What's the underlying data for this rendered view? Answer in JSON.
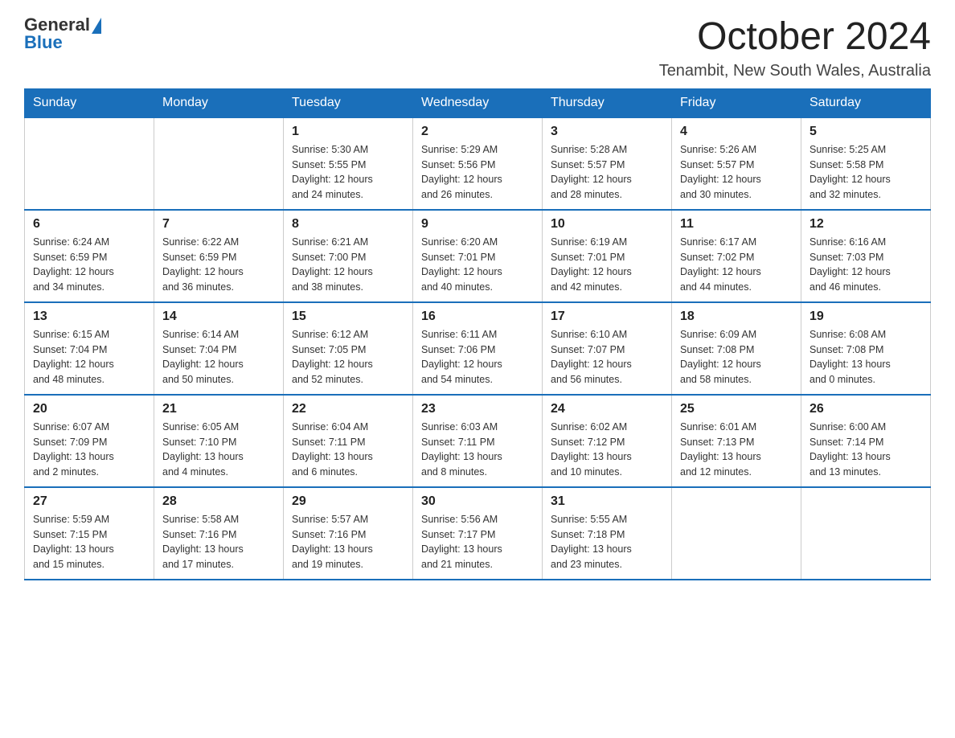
{
  "header": {
    "logo_general": "General",
    "logo_blue": "Blue",
    "month_year": "October 2024",
    "location": "Tenambit, New South Wales, Australia"
  },
  "weekdays": [
    "Sunday",
    "Monday",
    "Tuesday",
    "Wednesday",
    "Thursday",
    "Friday",
    "Saturday"
  ],
  "weeks": [
    [
      {
        "day": "",
        "info": ""
      },
      {
        "day": "",
        "info": ""
      },
      {
        "day": "1",
        "info": "Sunrise: 5:30 AM\nSunset: 5:55 PM\nDaylight: 12 hours\nand 24 minutes."
      },
      {
        "day": "2",
        "info": "Sunrise: 5:29 AM\nSunset: 5:56 PM\nDaylight: 12 hours\nand 26 minutes."
      },
      {
        "day": "3",
        "info": "Sunrise: 5:28 AM\nSunset: 5:57 PM\nDaylight: 12 hours\nand 28 minutes."
      },
      {
        "day": "4",
        "info": "Sunrise: 5:26 AM\nSunset: 5:57 PM\nDaylight: 12 hours\nand 30 minutes."
      },
      {
        "day": "5",
        "info": "Sunrise: 5:25 AM\nSunset: 5:58 PM\nDaylight: 12 hours\nand 32 minutes."
      }
    ],
    [
      {
        "day": "6",
        "info": "Sunrise: 6:24 AM\nSunset: 6:59 PM\nDaylight: 12 hours\nand 34 minutes."
      },
      {
        "day": "7",
        "info": "Sunrise: 6:22 AM\nSunset: 6:59 PM\nDaylight: 12 hours\nand 36 minutes."
      },
      {
        "day": "8",
        "info": "Sunrise: 6:21 AM\nSunset: 7:00 PM\nDaylight: 12 hours\nand 38 minutes."
      },
      {
        "day": "9",
        "info": "Sunrise: 6:20 AM\nSunset: 7:01 PM\nDaylight: 12 hours\nand 40 minutes."
      },
      {
        "day": "10",
        "info": "Sunrise: 6:19 AM\nSunset: 7:01 PM\nDaylight: 12 hours\nand 42 minutes."
      },
      {
        "day": "11",
        "info": "Sunrise: 6:17 AM\nSunset: 7:02 PM\nDaylight: 12 hours\nand 44 minutes."
      },
      {
        "day": "12",
        "info": "Sunrise: 6:16 AM\nSunset: 7:03 PM\nDaylight: 12 hours\nand 46 minutes."
      }
    ],
    [
      {
        "day": "13",
        "info": "Sunrise: 6:15 AM\nSunset: 7:04 PM\nDaylight: 12 hours\nand 48 minutes."
      },
      {
        "day": "14",
        "info": "Sunrise: 6:14 AM\nSunset: 7:04 PM\nDaylight: 12 hours\nand 50 minutes."
      },
      {
        "day": "15",
        "info": "Sunrise: 6:12 AM\nSunset: 7:05 PM\nDaylight: 12 hours\nand 52 minutes."
      },
      {
        "day": "16",
        "info": "Sunrise: 6:11 AM\nSunset: 7:06 PM\nDaylight: 12 hours\nand 54 minutes."
      },
      {
        "day": "17",
        "info": "Sunrise: 6:10 AM\nSunset: 7:07 PM\nDaylight: 12 hours\nand 56 minutes."
      },
      {
        "day": "18",
        "info": "Sunrise: 6:09 AM\nSunset: 7:08 PM\nDaylight: 12 hours\nand 58 minutes."
      },
      {
        "day": "19",
        "info": "Sunrise: 6:08 AM\nSunset: 7:08 PM\nDaylight: 13 hours\nand 0 minutes."
      }
    ],
    [
      {
        "day": "20",
        "info": "Sunrise: 6:07 AM\nSunset: 7:09 PM\nDaylight: 13 hours\nand 2 minutes."
      },
      {
        "day": "21",
        "info": "Sunrise: 6:05 AM\nSunset: 7:10 PM\nDaylight: 13 hours\nand 4 minutes."
      },
      {
        "day": "22",
        "info": "Sunrise: 6:04 AM\nSunset: 7:11 PM\nDaylight: 13 hours\nand 6 minutes."
      },
      {
        "day": "23",
        "info": "Sunrise: 6:03 AM\nSunset: 7:11 PM\nDaylight: 13 hours\nand 8 minutes."
      },
      {
        "day": "24",
        "info": "Sunrise: 6:02 AM\nSunset: 7:12 PM\nDaylight: 13 hours\nand 10 minutes."
      },
      {
        "day": "25",
        "info": "Sunrise: 6:01 AM\nSunset: 7:13 PM\nDaylight: 13 hours\nand 12 minutes."
      },
      {
        "day": "26",
        "info": "Sunrise: 6:00 AM\nSunset: 7:14 PM\nDaylight: 13 hours\nand 13 minutes."
      }
    ],
    [
      {
        "day": "27",
        "info": "Sunrise: 5:59 AM\nSunset: 7:15 PM\nDaylight: 13 hours\nand 15 minutes."
      },
      {
        "day": "28",
        "info": "Sunrise: 5:58 AM\nSunset: 7:16 PM\nDaylight: 13 hours\nand 17 minutes."
      },
      {
        "day": "29",
        "info": "Sunrise: 5:57 AM\nSunset: 7:16 PM\nDaylight: 13 hours\nand 19 minutes."
      },
      {
        "day": "30",
        "info": "Sunrise: 5:56 AM\nSunset: 7:17 PM\nDaylight: 13 hours\nand 21 minutes."
      },
      {
        "day": "31",
        "info": "Sunrise: 5:55 AM\nSunset: 7:18 PM\nDaylight: 13 hours\nand 23 minutes."
      },
      {
        "day": "",
        "info": ""
      },
      {
        "day": "",
        "info": ""
      }
    ]
  ]
}
